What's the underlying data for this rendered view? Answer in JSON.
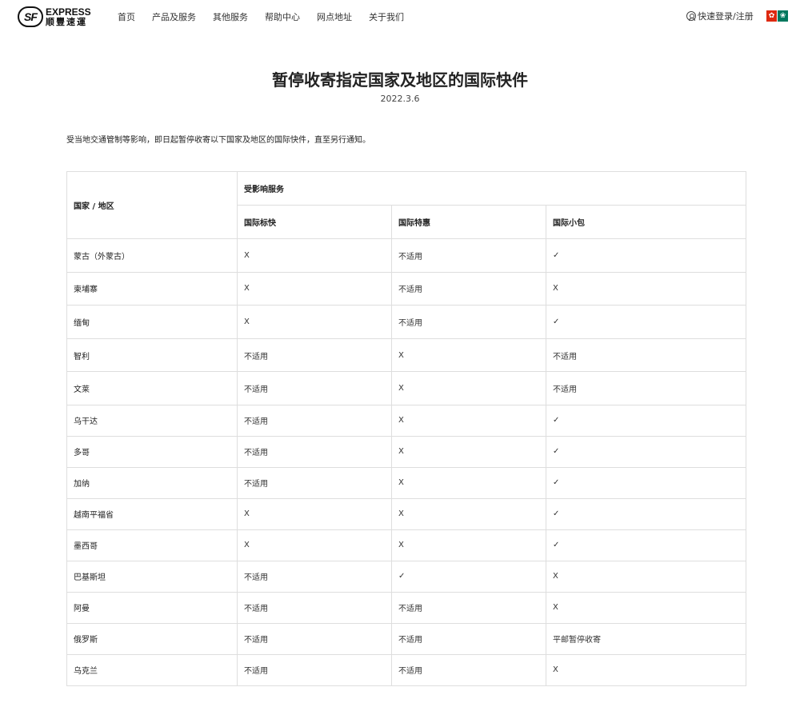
{
  "header": {
    "logo_en": "EXPRESS",
    "logo_cn": "顺豐速運",
    "logo_mark": "SF",
    "nav": [
      "首页",
      "产品及服务",
      "其他服务",
      "帮助中心",
      "网点地址",
      "关于我们"
    ],
    "login": "快速登录/注册"
  },
  "page": {
    "title": "暂停收寄指定国家及地区的国际快件",
    "date": "2022.3.6",
    "intro": "受当地交通管制等影响，即日起暂停收寄以下国家及地区的国际快件，直至另行通知。"
  },
  "table": {
    "col_country": "国家 / 地区",
    "col_group": "受影响服务",
    "services": [
      "国际标快",
      "国际特惠",
      "国际小包"
    ],
    "rows": [
      {
        "country": "蒙古（外蒙古）",
        "v": [
          "X",
          "不适用",
          "✓"
        ]
      },
      {
        "country": "柬埔寨",
        "v": [
          "X",
          "不适用",
          "X"
        ]
      },
      {
        "country": "缅甸",
        "v": [
          "X",
          "不适用",
          "✓"
        ]
      },
      {
        "country": "智利",
        "v": [
          "不适用",
          "X",
          "不适用"
        ]
      },
      {
        "country": "文莱",
        "v": [
          "不适用",
          "X",
          "不适用"
        ]
      },
      {
        "country": "乌干达",
        "v": [
          "不适用",
          "X",
          "✓"
        ]
      },
      {
        "country": "多哥",
        "v": [
          "不适用",
          "X",
          "✓"
        ]
      },
      {
        "country": "加纳",
        "v": [
          "不适用",
          "X",
          "✓"
        ]
      },
      {
        "country": "越南平福省",
        "v": [
          "X",
          "X",
          "✓"
        ]
      },
      {
        "country": "墨西哥",
        "v": [
          "X",
          "X",
          "✓"
        ]
      },
      {
        "country": "巴基斯坦",
        "v": [
          "不适用",
          "✓",
          "X"
        ]
      },
      {
        "country": "阿曼",
        "v": [
          "不适用",
          "不适用",
          "X"
        ]
      },
      {
        "country": "俄罗斯",
        "v": [
          "不适用",
          "不适用",
          "平邮暂停收寄"
        ]
      },
      {
        "country": "乌克兰",
        "v": [
          "不适用",
          "不适用",
          "X"
        ]
      }
    ]
  }
}
